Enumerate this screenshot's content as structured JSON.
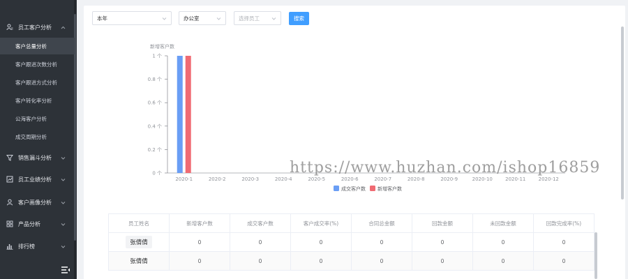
{
  "sidebar": {
    "groups": [
      {
        "label": "员工客户分析",
        "icon": "user-analysis-icon",
        "expanded": true
      },
      {
        "label": "销售漏斗分析",
        "icon": "funnel-icon",
        "expanded": false
      },
      {
        "label": "员工业绩分析",
        "icon": "performance-chart-icon",
        "expanded": false
      },
      {
        "label": "客户画像分析",
        "icon": "customer-profile-icon",
        "expanded": false
      },
      {
        "label": "产品分析",
        "icon": "product-grid-icon",
        "expanded": false
      },
      {
        "label": "排行榜",
        "icon": "bar-ranking-icon",
        "expanded": false
      }
    ],
    "sub_items": [
      {
        "label": "客户总量分析",
        "active": true
      },
      {
        "label": "客户跟进次数分析",
        "active": false
      },
      {
        "label": "客户跟进方式分析",
        "active": false
      },
      {
        "label": "客户转化率分析",
        "active": false
      },
      {
        "label": "公海客户分析",
        "active": false
      },
      {
        "label": "成交周期分析",
        "active": false
      }
    ],
    "collapse_icon": "menu-fold-icon"
  },
  "filters": {
    "period": "本年",
    "department": "办公室",
    "employee_placeholder": "选择员工",
    "search_label": "搜索"
  },
  "chart_data": {
    "type": "bar",
    "ylabel": "新增客户数",
    "y_ticks": [
      "0 个",
      "0.2 个",
      "0.4 个",
      "0.6 个",
      "0.8 个",
      "1 个"
    ],
    "ylim": [
      0,
      1
    ],
    "categories": [
      "2020-1",
      "2020-2",
      "2020-3",
      "2020-4",
      "2020-5",
      "2020-6",
      "2020-7",
      "2020-8",
      "2020-9",
      "2020-10",
      "2020-11",
      "2020-12"
    ],
    "series": [
      {
        "name": "成交客户数",
        "color": "#6a9ef5",
        "values": [
          1,
          0,
          0,
          0,
          0,
          0,
          0,
          0,
          0,
          0,
          0,
          0
        ]
      },
      {
        "name": "新增客户数",
        "color": "#f06b73",
        "values": [
          1,
          0,
          0,
          0,
          0,
          0,
          0,
          0,
          0,
          0,
          0,
          0
        ]
      }
    ],
    "legend_position": "bottom-center",
    "grid": false
  },
  "table": {
    "headers": [
      "员工姓名",
      "新增客户数",
      "成交客户数",
      "客户成交率(%)",
      "合同总金额",
      "回款金额",
      "未回款金额",
      "回款完成率(%)"
    ],
    "rows": [
      [
        "张倩倩",
        "0",
        "0",
        "0",
        "0",
        "0",
        "0",
        "0"
      ],
      [
        "张倩倩",
        "0",
        "0",
        "0",
        "0",
        "0",
        "0",
        "0"
      ]
    ]
  },
  "watermark": "https://www.huzhan.com/ishop16859"
}
